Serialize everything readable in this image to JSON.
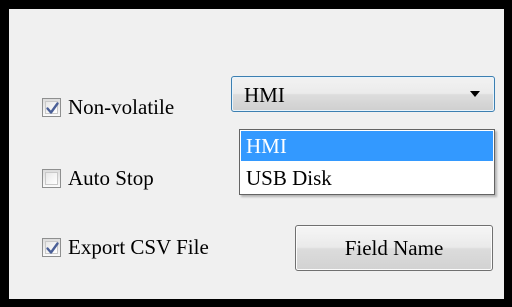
{
  "checkboxes": [
    {
      "label": "Non-volatile",
      "checked": true
    },
    {
      "label": "Auto Stop",
      "checked": false
    },
    {
      "label": "Export CSV File",
      "checked": true
    }
  ],
  "storage_combo": {
    "value": "HMI",
    "expanded": true,
    "options": [
      {
        "label": "HMI",
        "selected": true
      },
      {
        "label": "USB Disk",
        "selected": false
      }
    ]
  },
  "field_name_button": {
    "label": "Field Name"
  },
  "colors": {
    "highlight": "#3399ff",
    "panel_bg": "#f0f0f0",
    "frame_border": "#000000",
    "check_mark": "#4a5f97"
  },
  "icons": {
    "check": "checkmark-icon",
    "combo_arrow": "chevron-down-icon"
  }
}
